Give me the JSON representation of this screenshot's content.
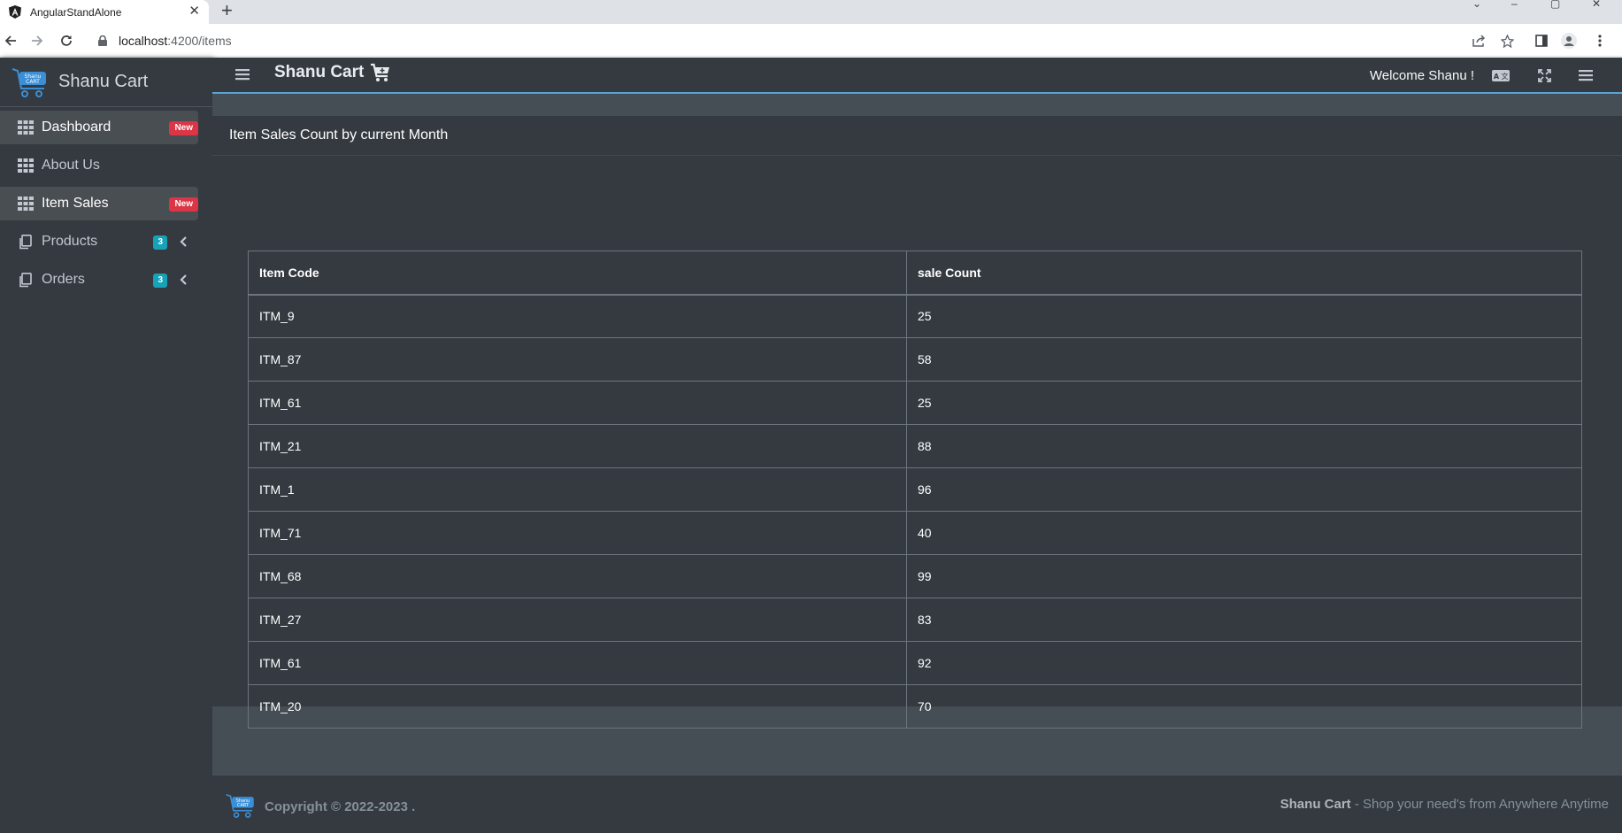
{
  "browser": {
    "tab_title": "AngularStandAlone",
    "url_host": "localhost",
    "url_rest": ":4200/items"
  },
  "sidebar": {
    "brand": "Shanu Cart",
    "logo_text": "Shanu CART",
    "items": [
      {
        "label": "Dashboard",
        "icon": "grid-icon",
        "badge": "New",
        "active": true
      },
      {
        "label": "About Us",
        "icon": "grid-icon",
        "badge": "",
        "active": false
      },
      {
        "label": "Item Sales",
        "icon": "grid-icon",
        "badge": "New",
        "active": true
      },
      {
        "label": "Products",
        "icon": "copy-icon",
        "count": "3",
        "active": false
      },
      {
        "label": "Orders",
        "icon": "copy-icon",
        "count": "3",
        "active": false
      }
    ]
  },
  "topnav": {
    "title": "Shanu Cart",
    "welcome": "Welcome Shanu !"
  },
  "card": {
    "title": "Item Sales Count by current Month",
    "columns": [
      "Item Code",
      "sale Count"
    ],
    "rows": [
      [
        "ITM_9",
        "25"
      ],
      [
        "ITM_87",
        "58"
      ],
      [
        "ITM_61",
        "25"
      ],
      [
        "ITM_21",
        "88"
      ],
      [
        "ITM_1",
        "96"
      ],
      [
        "ITM_71",
        "40"
      ],
      [
        "ITM_68",
        "99"
      ],
      [
        "ITM_27",
        "83"
      ],
      [
        "ITM_61",
        "92"
      ],
      [
        "ITM_20",
        "70"
      ]
    ]
  },
  "footer": {
    "copyright": "Copyright © 2022-2023 .",
    "brand": "Shanu Cart",
    "tagline": " - Shop your need's from Anywhere Anytime"
  },
  "colors": {
    "sidebar_bg": "#343a40",
    "content_bg": "#454d55",
    "badge_red": "#dc3545",
    "badge_teal": "#17a2b8",
    "accent_line": "#5aa4d6"
  }
}
